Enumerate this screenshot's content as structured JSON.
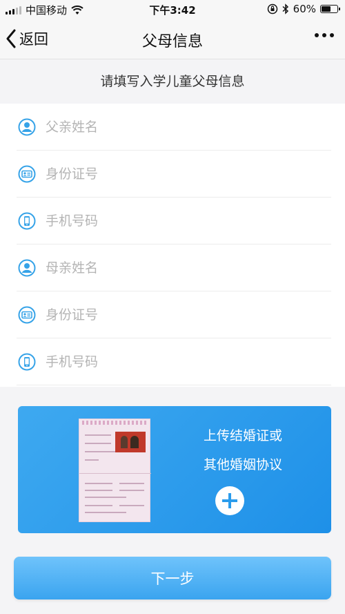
{
  "status_bar": {
    "carrier": "中国移动",
    "time": "下午3:42",
    "battery_text": "60%",
    "battery_level": 0.6
  },
  "nav": {
    "back_label": "返回",
    "title": "父母信息"
  },
  "subtitle": "请填写入学儿童父母信息",
  "form": {
    "fields": [
      {
        "placeholder": "父亲姓名",
        "icon": "person-icon"
      },
      {
        "placeholder": "身份证号",
        "icon": "id-card-icon"
      },
      {
        "placeholder": "手机号码",
        "icon": "phone-icon"
      },
      {
        "placeholder": "母亲姓名",
        "icon": "person-icon"
      },
      {
        "placeholder": "身份证号",
        "icon": "id-card-icon"
      },
      {
        "placeholder": "手机号码",
        "icon": "phone-icon"
      }
    ]
  },
  "upload": {
    "line1": "上传结婚证或",
    "line2": "其他婚姻协议"
  },
  "next_label": "下一步",
  "colors": {
    "accent": "#2b9cec",
    "icon": "#36a3e8"
  }
}
